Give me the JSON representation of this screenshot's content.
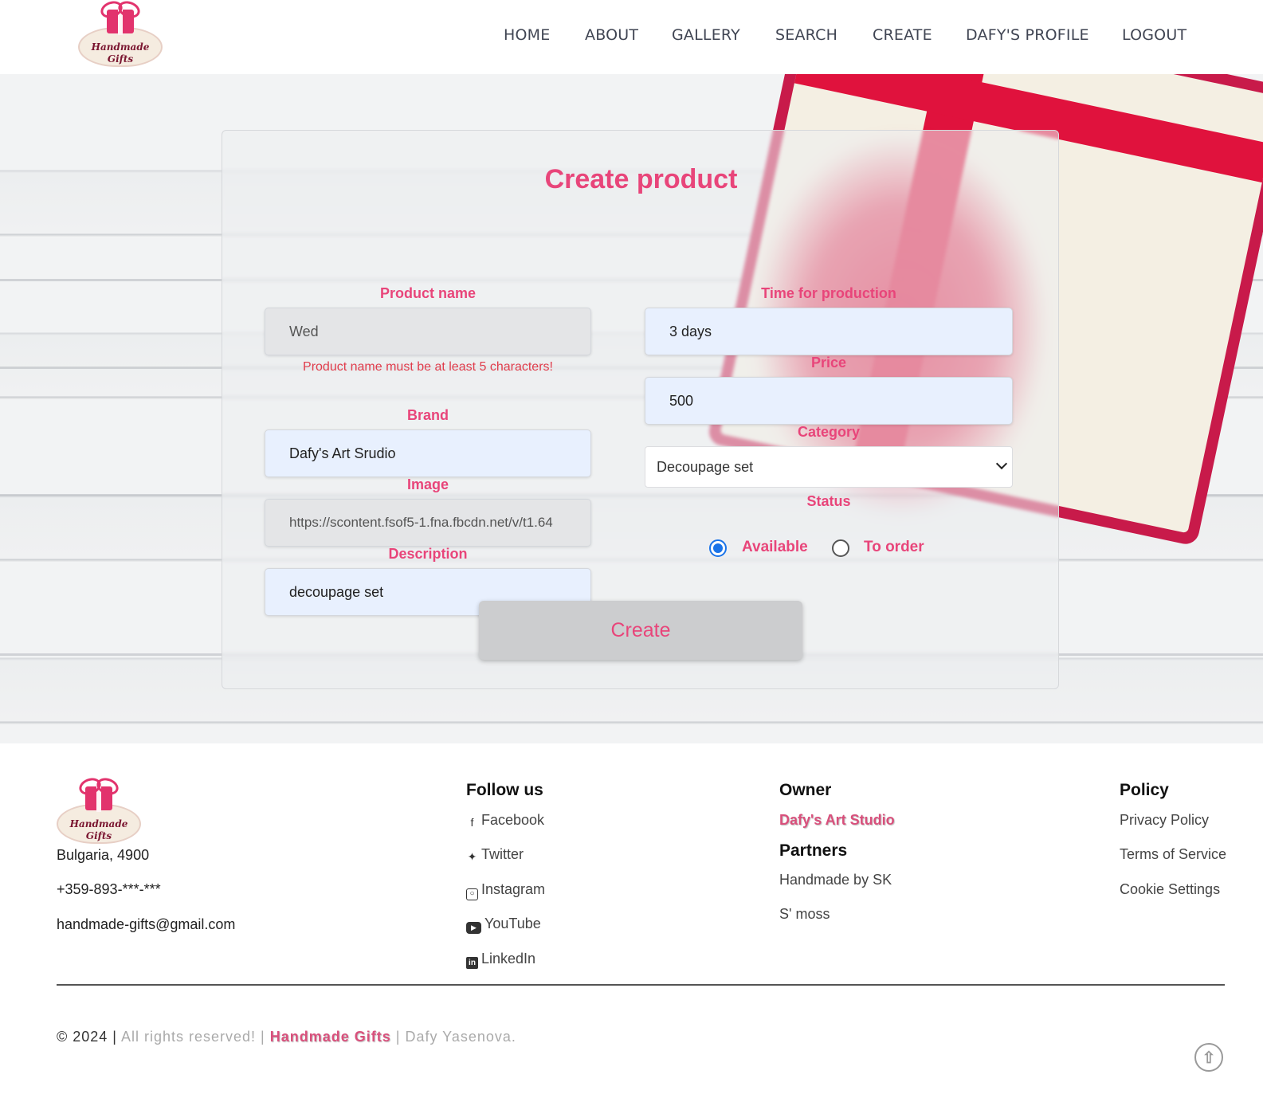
{
  "brand": {
    "logo_line1": "Handmade",
    "logo_line2": "Gifts"
  },
  "nav": {
    "home": "HOME",
    "about": "ABOUT",
    "gallery": "GALLERY",
    "search": "SEARCH",
    "create": "CREATE",
    "profile": "DAFY'S PROFILE",
    "logout": "LOGOUT"
  },
  "form": {
    "title": "Create product",
    "product_name": {
      "label": "Product name",
      "value": "Wed",
      "error": "Product name must be at least 5 characters!"
    },
    "brand": {
      "label": "Brand",
      "value": "Dafy's Art Srudio"
    },
    "image": {
      "label": "Image",
      "value": "https://scontent.fsof5-1.fna.fbcdn.net/v/t1.64"
    },
    "description": {
      "label": "Description",
      "value": "decoupage set"
    },
    "time": {
      "label": "Time for production",
      "value": "3 days"
    },
    "price": {
      "label": "Price",
      "value": "500"
    },
    "category": {
      "label": "Category",
      "value": "Decoupage set"
    },
    "status": {
      "label": "Status",
      "option_available": "Available",
      "option_order": "To order",
      "selected": "Available"
    },
    "submit": "Create"
  },
  "footer": {
    "address": "Bulgaria, 4900",
    "phone": "+359-893-***-***",
    "email": "handmade-gifts@gmail.com",
    "follow_heading": "Follow us",
    "social": {
      "facebook": "Facebook",
      "twitter": "Twitter",
      "instagram": "Instagram",
      "youtube": "YouTube",
      "linkedin": "LinkedIn"
    },
    "owner_heading": "Owner",
    "owner": "Dafy's Art Studio",
    "partners_heading": "Partners",
    "partners": [
      "Handmade by SK",
      "S' moss"
    ],
    "policy_heading": "Policy",
    "policy": [
      "Privacy Policy",
      "Terms of Service",
      "Cookie Settings"
    ],
    "copyright_year": "© 2024 |",
    "copyright_rights": "All rights reserved! |",
    "copyright_brand": "Handmade Gifts",
    "copyright_author": "| Dafy Yasenova."
  },
  "colors": {
    "accent": "#e8457a",
    "input_bg": "#e8f0fe",
    "radio": "#1a73e8"
  },
  "icons": [
    "gift-logo-icon",
    "facebook-icon",
    "twitter-icon",
    "instagram-icon",
    "youtube-icon",
    "linkedin-icon",
    "arrow-up-icon"
  ]
}
